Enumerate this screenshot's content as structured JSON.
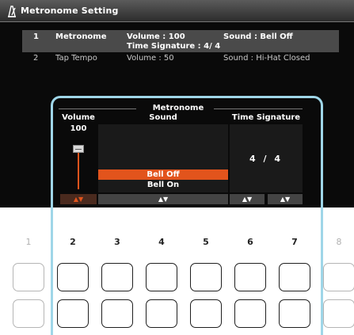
{
  "window": {
    "title": "Metronome Setting",
    "title_icon": "metronome-icon"
  },
  "list": [
    {
      "num": "1",
      "name": "Metronome",
      "volume": "Volume :  100",
      "time_signature": "Time Signature :   4/ 4",
      "sound": "Sound :  Bell Off",
      "selected": true
    },
    {
      "num": "2",
      "name": "Tap Tempo",
      "volume": "Volume :  50",
      "sound": "Sound :  Hi-Hat Closed",
      "selected": false
    }
  ],
  "panel": {
    "title": "Metronome",
    "volume_header": "Volume",
    "volume_value": "100",
    "volume_level": 1.0,
    "sound_header": "Sound",
    "sound_options": [
      "Bell Off",
      "Bell On"
    ],
    "sound_selected": "Bell Off",
    "ts_header": "Time Signature",
    "ts_numerator": "4",
    "ts_sep": "/",
    "ts_denominator": "4",
    "arrow_glyph": "▲▼"
  },
  "buttons": {
    "numbers": [
      "1",
      "2",
      "3",
      "4",
      "5",
      "6",
      "7",
      "8"
    ]
  },
  "colors": {
    "accent": "#e2541c",
    "frame": "#9fd6e8",
    "screen_bg": "#0a0a0a"
  }
}
